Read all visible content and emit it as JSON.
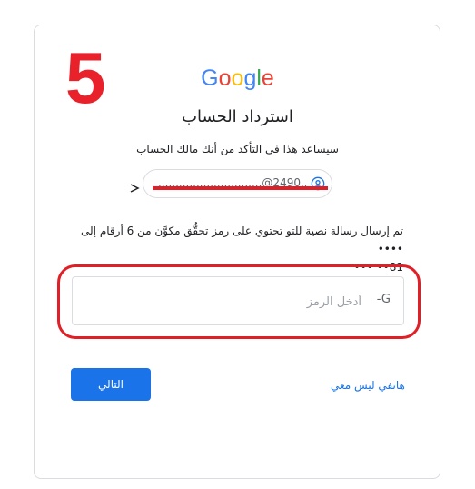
{
  "annotation": {
    "step_number": "5"
  },
  "header": {
    "logo_letters": [
      {
        "char": "G",
        "color": "#4285F4"
      },
      {
        "char": "o",
        "color": "#EA4335"
      },
      {
        "char": "o",
        "color": "#FBBC05"
      },
      {
        "char": "g",
        "color": "#4285F4"
      },
      {
        "char": "l",
        "color": "#34A853"
      },
      {
        "char": "e",
        "color": "#EA4335"
      }
    ],
    "title": "استرداد الحساب",
    "subtitle": "سيساعد هذا في التأكد من أنك مالك الحساب"
  },
  "account_chip": {
    "email": "..............................@2490.................",
    "icon": "account-circle-icon"
  },
  "message": {
    "line1": "تم إرسال رسالة نصية للتو تحتوي على رمز تحقُّق مكوَّن من 6 أرقام إلى ••••",
    "line2": "••• ••81"
  },
  "code_field": {
    "prefix": "-G",
    "placeholder": "أدخل الرمز"
  },
  "actions": {
    "next_label": "التالي",
    "alt_link": "هاتفي ليس معي"
  },
  "colors": {
    "primary": "#1a73e8",
    "annotation_red": "#e11f26",
    "border": "#dadce0"
  }
}
